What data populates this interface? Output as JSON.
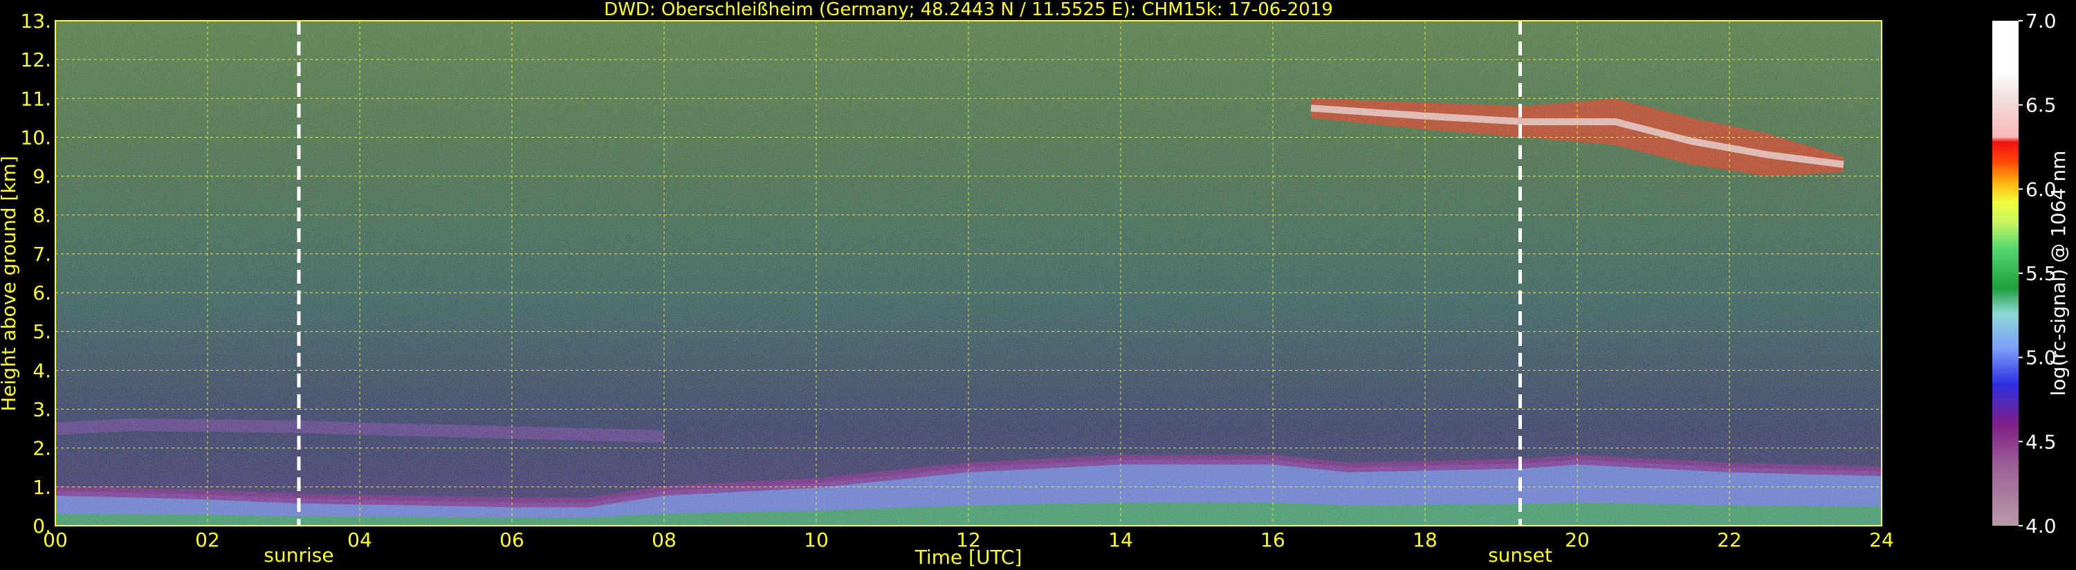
{
  "chart_data": {
    "type": "heatmap",
    "title": "DWD: Oberschleißheim (Germany; 48.2443 N / 11.5525 E):    CHM15k: 17-06-2019",
    "xlabel": "Time [UTC]",
    "ylabel": "Height above ground [km]",
    "xlim": [
      0,
      24
    ],
    "ylim": [
      0,
      13
    ],
    "x_ticks": [
      "00",
      "02",
      "04",
      "06",
      "08",
      "10",
      "12",
      "14",
      "16",
      "18",
      "20",
      "22",
      "24"
    ],
    "y_ticks": [
      "0.",
      "1.",
      "2.",
      "3.",
      "4.",
      "5.",
      "6.",
      "7.",
      "8.",
      "9.",
      "10.",
      "11.",
      "12.",
      "13."
    ],
    "grid": true,
    "colorbar": {
      "label": "log(rc-signal) @ 1064 nm",
      "range": [
        4.0,
        7.0
      ],
      "ticks": [
        "4.0",
        "4.5",
        "5.0",
        "5.5",
        "6.0",
        "6.5",
        "7.0"
      ],
      "colors": [
        "#b89aa8",
        "#a87da0",
        "#9c5f96",
        "#8e3f8e",
        "#7e1f88",
        "#6a0a8a",
        "#4a10b0",
        "#2e2ee0",
        "#3a55f0",
        "#5a7cf5",
        "#7a9ef8",
        "#99b8fa",
        "#8fd8d8",
        "#5cc08a",
        "#1f9e3c",
        "#0f8a2a",
        "#28b84a",
        "#55d870",
        "#8fef80",
        "#c8f560",
        "#eeff40",
        "#ffe020",
        "#ffb010",
        "#ff8008",
        "#ff4a08",
        "#f01010",
        "#f8b8b8",
        "#f0e0e0",
        "#ffffff"
      ]
    },
    "markers": [
      {
        "label": "sunrise",
        "x": 3.2
      },
      {
        "label": "sunset",
        "x": 19.25
      }
    ],
    "features": [
      {
        "name": "boundary_layer_top",
        "x": [
          0,
          2,
          3.2,
          6,
          7,
          8,
          10,
          12,
          14,
          16,
          17,
          19.3,
          20,
          22,
          24
        ],
        "y": [
          0.9,
          0.8,
          0.7,
          0.6,
          0.6,
          0.9,
          1.1,
          1.5,
          1.7,
          1.7,
          1.5,
          1.6,
          1.7,
          1.5,
          1.4
        ]
      },
      {
        "name": "cirrus_cloud_base",
        "x": [
          16.5,
          18,
          19.3,
          20.5,
          21.5,
          22.5,
          23.5
        ],
        "y": [
          10.5,
          10.2,
          10.0,
          9.8,
          9.3,
          9.0,
          9.1
        ]
      },
      {
        "name": "cirrus_cloud_top",
        "x": [
          16.5,
          18,
          19.3,
          20.5,
          21.5,
          22.5,
          23.5
        ],
        "y": [
          11.0,
          10.9,
          10.8,
          11.0,
          10.5,
          10.1,
          9.5
        ]
      },
      {
        "name": "residual_layer",
        "x": [
          0,
          1,
          3.2,
          4,
          6,
          8
        ],
        "y": [
          2.5,
          2.6,
          2.55,
          2.5,
          2.4,
          2.3
        ]
      }
    ]
  }
}
